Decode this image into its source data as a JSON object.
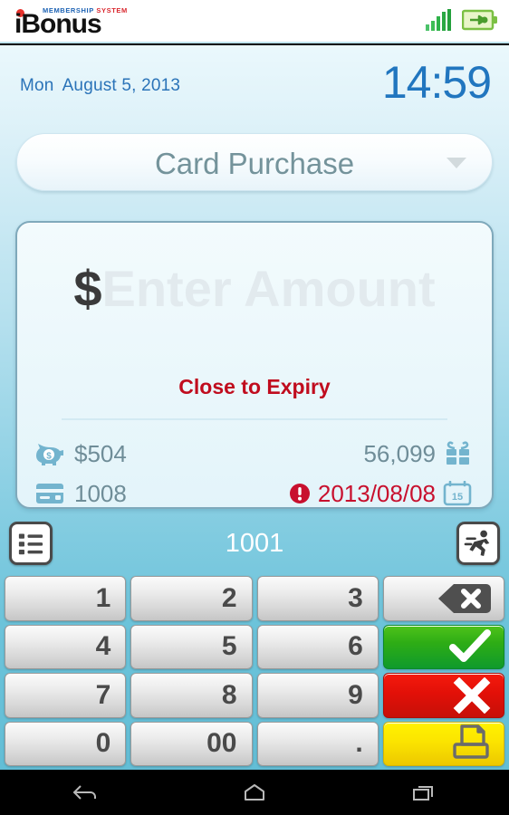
{
  "app": {
    "logo_word": "iBonus",
    "logo_tagline_membership": "MEMBERSHIP",
    "logo_tagline_system": "SYSTEM"
  },
  "status_bar": {
    "signal_icon": "signal-bars-icon",
    "battery_icon": "battery-charging-icon",
    "accent_green": "#2fb24a"
  },
  "header": {
    "day_of_week": "Mon",
    "date": "August 5, 2013",
    "time": "14:59",
    "text_color": "#2176bf"
  },
  "transaction_selector": {
    "selected": "Card Purchase",
    "caret_icon": "chevron-down-icon"
  },
  "amount_field": {
    "currency_symbol": "$",
    "placeholder": "Enter Amount",
    "value": ""
  },
  "card_status": {
    "expiry_warning": "Close to Expiry",
    "warning_color": "#c00c1e"
  },
  "balances": {
    "stored_value": {
      "icon": "piggy-bank-icon",
      "value": "$504"
    },
    "points": {
      "icon": "gift-icon",
      "value": "56,099"
    },
    "card_number": {
      "icon": "credit-card-icon",
      "value": "1008"
    },
    "expiry_date": {
      "icon": "calendar-icon",
      "calendar_day": "15",
      "alert_icon": "exclamation-circle-icon",
      "value": "2013/08/08"
    }
  },
  "member_bar": {
    "list_button_icon": "list-icon",
    "member_id": "1001",
    "runner_button_icon": "running-person-icon"
  },
  "keypad": {
    "keys": [
      {
        "name": "key-1",
        "label": "1",
        "style": "gray",
        "icon": ""
      },
      {
        "name": "key-2",
        "label": "2",
        "style": "gray",
        "icon": ""
      },
      {
        "name": "key-3",
        "label": "3",
        "style": "gray",
        "icon": ""
      },
      {
        "name": "key-backspace",
        "label": "",
        "style": "gray",
        "icon": "backspace-icon"
      },
      {
        "name": "key-4",
        "label": "4",
        "style": "gray",
        "icon": ""
      },
      {
        "name": "key-5",
        "label": "5",
        "style": "gray",
        "icon": ""
      },
      {
        "name": "key-6",
        "label": "6",
        "style": "gray",
        "icon": ""
      },
      {
        "name": "key-confirm",
        "label": "",
        "style": "green",
        "icon": "checkmark-icon"
      },
      {
        "name": "key-7",
        "label": "7",
        "style": "gray",
        "icon": ""
      },
      {
        "name": "key-8",
        "label": "8",
        "style": "gray",
        "icon": ""
      },
      {
        "name": "key-9",
        "label": "9",
        "style": "gray",
        "icon": ""
      },
      {
        "name": "key-cancel",
        "label": "",
        "style": "red",
        "icon": "cross-icon"
      },
      {
        "name": "key-0",
        "label": "0",
        "style": "gray",
        "icon": ""
      },
      {
        "name": "key-double-zero",
        "label": "00",
        "style": "gray",
        "icon": ""
      },
      {
        "name": "key-decimal-point",
        "label": ".",
        "style": "gray",
        "icon": ""
      },
      {
        "name": "key-print",
        "label": "",
        "style": "yellow",
        "icon": "printer-icon"
      }
    ],
    "colors": {
      "confirm_green": "#2ead15",
      "cancel_red": "#e21008",
      "print_yellow": "#fbe400"
    }
  },
  "android_nav": {
    "back_icon": "back-arrow-icon",
    "home_icon": "home-icon",
    "recents_icon": "recent-apps-icon"
  }
}
